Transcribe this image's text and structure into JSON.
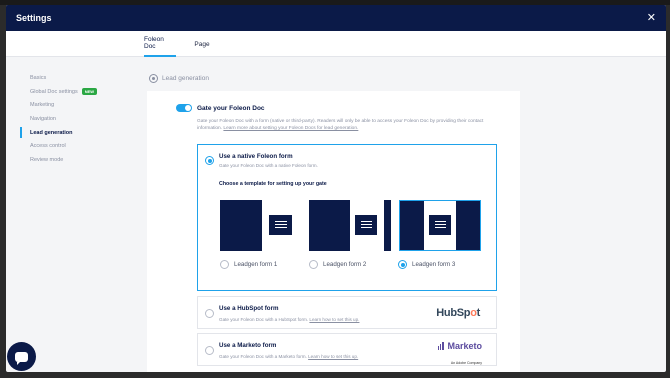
{
  "header": {
    "title": "Settings",
    "close_glyph": "✕"
  },
  "tabs": [
    {
      "label": "Foleon Doc",
      "active": true
    },
    {
      "label": "Page",
      "active": false
    }
  ],
  "sidebar": {
    "items": [
      {
        "label": "Basics",
        "active": false
      },
      {
        "label": "Global Doc settings",
        "active": false,
        "badge": "NEW"
      },
      {
        "label": "Marketing",
        "active": false
      },
      {
        "label": "Navigation",
        "active": false
      },
      {
        "label": "Lead generation",
        "active": true
      },
      {
        "label": "Access control",
        "active": false
      },
      {
        "label": "Review mode",
        "active": false
      }
    ]
  },
  "section": {
    "title": "Lead generation",
    "icon": "lead-generation-icon"
  },
  "gate": {
    "toggle_label": "Gate your Foleon Doc",
    "enabled": true,
    "description": "Gate your Foleon Doc with a form (native or third-party). Readers will only be able to access your Foleon Doc by providing their contact information.",
    "learn_more": "Learn more about setting your Foleon Docs for lead generation."
  },
  "options": {
    "native": {
      "title": "Use a native Foleon form",
      "desc": "Gate your Foleon Doc with a native Foleon form.",
      "selected": true,
      "choose_label": "Choose a template for setting up your gate",
      "templates": [
        {
          "label": "Leadgen form 1",
          "selected": false
        },
        {
          "label": "Leadgen form 2",
          "selected": false
        },
        {
          "label": "Leadgen form 3",
          "selected": true
        }
      ]
    },
    "hubspot": {
      "title": "Use a HubSpot form",
      "desc": "Gate your Foleon Doc with a HubSpot form.",
      "link": "Learn how to set this up.",
      "logo_pre": "HubSp",
      "logo_o": "o",
      "logo_post": "t"
    },
    "marketo": {
      "title": "Use a Marketo form",
      "desc": "Gate your Foleon Doc with a Marketo form.",
      "link": "Learn how to set this up.",
      "logo": "Marketo",
      "logo_sub": "An Adobe Company"
    }
  },
  "colors": {
    "navy": "#0b1a48",
    "accent": "#1fa2ea",
    "badge_green": "#2aa744"
  },
  "chat": {
    "icon": "chat-icon"
  }
}
